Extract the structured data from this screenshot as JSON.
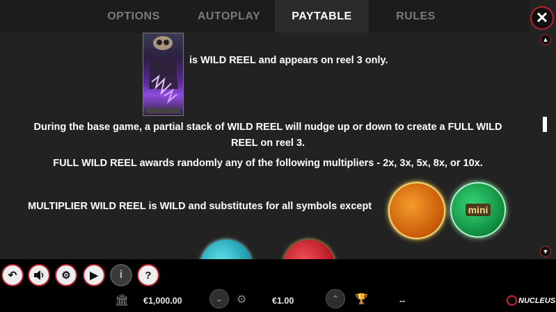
{
  "tabs": [
    {
      "label": "OPTIONS",
      "active": false
    },
    {
      "label": "AUTOPLAY",
      "active": false
    },
    {
      "label": "PAYTABLE",
      "active": true
    },
    {
      "label": "RULES",
      "active": false
    }
  ],
  "content": {
    "line1": "is WILD REEL and appears on reel 3 only.",
    "line2a": "During the base game, a partial stack of WILD REEL will nudge up or down to create a FULL WILD",
    "line2b": "REEL on reel 3.",
    "line3": "FULL WILD REEL awards randomly any of the following multipliers - 2x, 3x, 5x, 8x, or 10x.",
    "line4": "MULTIPLIER WILD REEL is WILD and substitutes for all symbols except",
    "mini_label": "mini"
  },
  "footer": {
    "balance": "€1,000.00",
    "bet": "€1.00",
    "win": "--",
    "brand": "NUCLEUS"
  },
  "colors": {
    "accent_red": "#b6222b",
    "orange_coin": "#e37a10",
    "green_coin": "#1db45a",
    "teal_coin": "#2ab9c9",
    "red_coin": "#d3202a"
  }
}
